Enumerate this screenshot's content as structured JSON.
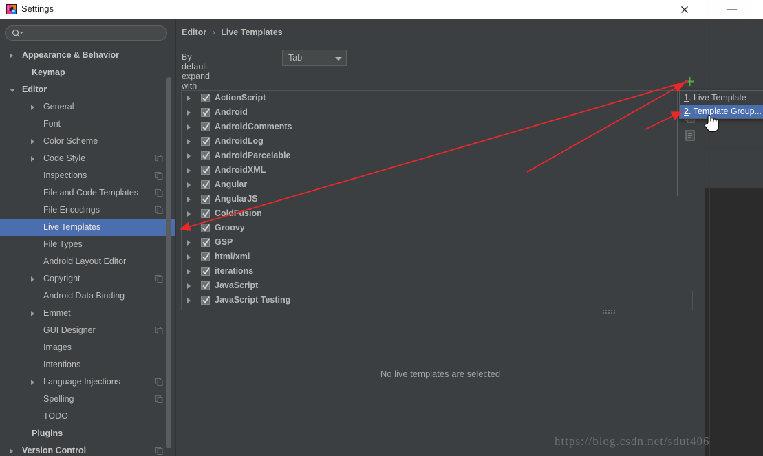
{
  "window": {
    "dialog_title": "Settings",
    "close_icon": "close-icon",
    "minimize_icon": "minimize-icon",
    "app_icon": "intellij-idea-icon"
  },
  "search": {
    "value": "",
    "placeholder": "",
    "icon": "search-icon"
  },
  "sidebar": {
    "items": [
      {
        "label": "Appearance & Behavior",
        "indent": 16,
        "arrow": "right",
        "bold": true,
        "selected": false,
        "copy": false
      },
      {
        "label": "Keymap",
        "indent": 30,
        "arrow": "none",
        "bold": true,
        "selected": false,
        "copy": false
      },
      {
        "label": "Editor",
        "indent": 16,
        "arrow": "down",
        "bold": true,
        "selected": false,
        "copy": false
      },
      {
        "label": "General",
        "indent": 47,
        "arrow": "right",
        "bold": false,
        "selected": false,
        "copy": false
      },
      {
        "label": "Font",
        "indent": 47,
        "arrow": "none",
        "bold": false,
        "selected": false,
        "copy": false
      },
      {
        "label": "Color Scheme",
        "indent": 47,
        "arrow": "right",
        "bold": false,
        "selected": false,
        "copy": false
      },
      {
        "label": "Code Style",
        "indent": 47,
        "arrow": "right",
        "bold": false,
        "selected": false,
        "copy": true
      },
      {
        "label": "Inspections",
        "indent": 47,
        "arrow": "none",
        "bold": false,
        "selected": false,
        "copy": true
      },
      {
        "label": "File and Code Templates",
        "indent": 47,
        "arrow": "none",
        "bold": false,
        "selected": false,
        "copy": true
      },
      {
        "label": "File Encodings",
        "indent": 47,
        "arrow": "none",
        "bold": false,
        "selected": false,
        "copy": true
      },
      {
        "label": "Live Templates",
        "indent": 47,
        "arrow": "none",
        "bold": false,
        "selected": true,
        "copy": false
      },
      {
        "label": "File Types",
        "indent": 47,
        "arrow": "none",
        "bold": false,
        "selected": false,
        "copy": false
      },
      {
        "label": "Android Layout Editor",
        "indent": 47,
        "arrow": "none",
        "bold": false,
        "selected": false,
        "copy": false
      },
      {
        "label": "Copyright",
        "indent": 47,
        "arrow": "right",
        "bold": false,
        "selected": false,
        "copy": true
      },
      {
        "label": "Android Data Binding",
        "indent": 47,
        "arrow": "none",
        "bold": false,
        "selected": false,
        "copy": false
      },
      {
        "label": "Emmet",
        "indent": 47,
        "arrow": "right",
        "bold": false,
        "selected": false,
        "copy": false
      },
      {
        "label": "GUI Designer",
        "indent": 47,
        "arrow": "none",
        "bold": false,
        "selected": false,
        "copy": true
      },
      {
        "label": "Images",
        "indent": 47,
        "arrow": "none",
        "bold": false,
        "selected": false,
        "copy": false
      },
      {
        "label": "Intentions",
        "indent": 47,
        "arrow": "none",
        "bold": false,
        "selected": false,
        "copy": false
      },
      {
        "label": "Language Injections",
        "indent": 47,
        "arrow": "right",
        "bold": false,
        "selected": false,
        "copy": true
      },
      {
        "label": "Spelling",
        "indent": 47,
        "arrow": "none",
        "bold": false,
        "selected": false,
        "copy": true
      },
      {
        "label": "TODO",
        "indent": 47,
        "arrow": "none",
        "bold": false,
        "selected": false,
        "copy": false
      },
      {
        "label": "Plugins",
        "indent": 30,
        "arrow": "none",
        "bold": true,
        "selected": false,
        "copy": false
      },
      {
        "label": "Version Control",
        "indent": 16,
        "arrow": "right",
        "bold": true,
        "selected": false,
        "copy": true
      }
    ]
  },
  "content": {
    "breadcrumb": {
      "parent": "Editor",
      "separator": "›",
      "current": "Live Templates"
    },
    "expand_with": {
      "label": "By default expand with",
      "value": "Tab"
    },
    "empty_message": "No live templates are selected",
    "template_groups": [
      {
        "name": "ActionScript",
        "checked": true
      },
      {
        "name": "Android",
        "checked": true
      },
      {
        "name": "AndroidComments",
        "checked": true
      },
      {
        "name": "AndroidLog",
        "checked": true
      },
      {
        "name": "AndroidParcelable",
        "checked": true
      },
      {
        "name": "AndroidXML",
        "checked": true
      },
      {
        "name": "Angular",
        "checked": true
      },
      {
        "name": "AngularJS",
        "checked": true
      },
      {
        "name": "ColdFusion",
        "checked": true
      },
      {
        "name": "Groovy",
        "checked": true
      },
      {
        "name": "GSP",
        "checked": true
      },
      {
        "name": "html/xml",
        "checked": true
      },
      {
        "name": "iterations",
        "checked": true
      },
      {
        "name": "JavaScript",
        "checked": true
      },
      {
        "name": "JavaScript Testing",
        "checked": true
      }
    ]
  },
  "toolbar": {
    "add_icon": "plus-icon",
    "copy_icon": "copy-icon",
    "doc_icon": "document-icon"
  },
  "popup_menu": {
    "items": [
      {
        "mnemonic": "1",
        "label": ". Live Template",
        "active": false
      },
      {
        "mnemonic": "2",
        "label": ". Template Group...",
        "active": true
      }
    ]
  },
  "watermark": "https://blog.csdn.net/sdut406",
  "colors": {
    "accent_selection": "#4b6eaf",
    "panel_bg": "#3c3f41",
    "editor_bg": "#2b2b2b",
    "add_green": "#4caf50",
    "annotation_red": "#e8282a",
    "text": "#bbbbbb"
  }
}
